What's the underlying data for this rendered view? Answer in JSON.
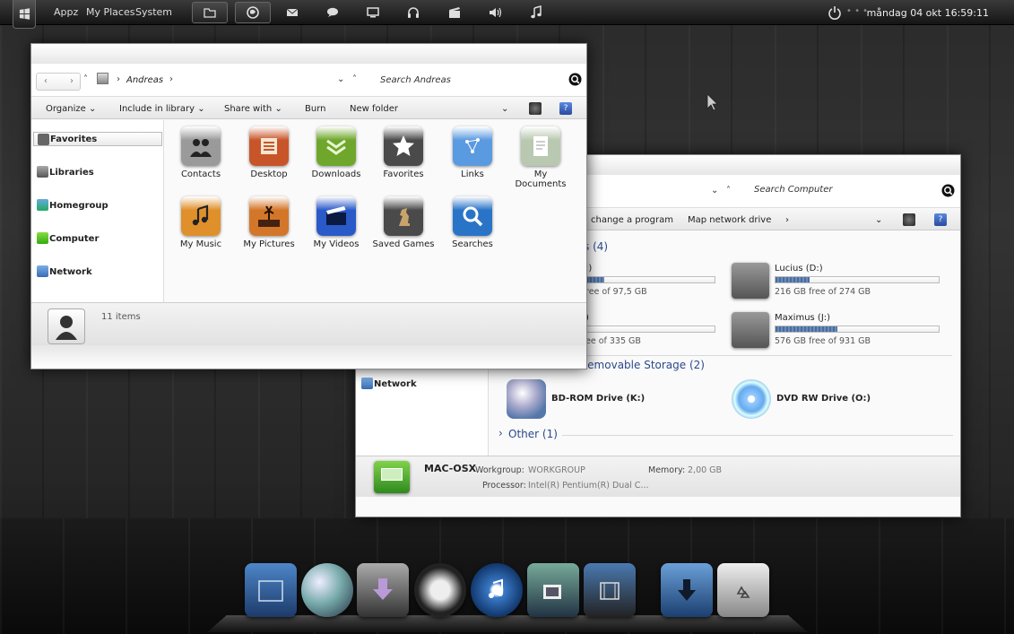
{
  "taskbar": {
    "menus": [
      "Appz",
      "My Places",
      "System"
    ],
    "clock": "måndag 04 okt  16:59:11",
    "icons": [
      "folder-icon",
      "firefox-icon",
      "mail-icon",
      "chat-icon",
      "monitor-icon",
      "headphones-icon",
      "film-icon",
      "volume-icon",
      "music-note-icon"
    ]
  },
  "window1": {
    "breadcrumb": "Andreas",
    "search_placeholder": "Search Andreas",
    "toolbar": [
      "Organize",
      "Include in library",
      "Share with",
      "Burn",
      "New folder"
    ],
    "sidebar": [
      "Favorites",
      "Libraries",
      "Homegroup",
      "Computer",
      "Network"
    ],
    "items": [
      {
        "label": "Contacts",
        "icon": "contacts-icon",
        "color": "#9a9a9a"
      },
      {
        "label": "Desktop",
        "icon": "desktop-icon",
        "color": "#c8552a"
      },
      {
        "label": "Downloads",
        "icon": "downloads-icon",
        "color": "#6ea72c"
      },
      {
        "label": "Favorites",
        "icon": "star-icon",
        "color": "#4a4a4a"
      },
      {
        "label": "Links",
        "icon": "links-icon",
        "color": "#5a9ae0"
      },
      {
        "label": "My Documents",
        "icon": "documents-icon",
        "color": "#b9c8b0"
      },
      {
        "label": "My Music",
        "icon": "music-icon",
        "color": "#e0902a"
      },
      {
        "label": "My Pictures",
        "icon": "pictures-icon",
        "color": "#d4762a"
      },
      {
        "label": "My Videos",
        "icon": "videos-icon",
        "color": "#2a5ac8"
      },
      {
        "label": "Saved Games",
        "icon": "chess-icon",
        "color": "#4a4a4a"
      },
      {
        "label": "Searches",
        "icon": "search-icon",
        "color": "#2a74c8"
      }
    ],
    "status": "11 items"
  },
  "window2": {
    "search_placeholder": "Search Computer",
    "toolbar": [
      "change a program",
      "Map network drive"
    ],
    "sidebar_network": "Network",
    "hdd_group": "s (4)",
    "drives": [
      {
        "name": ":)",
        "free": "ree of 97,5 GB",
        "fill": 0.1
      },
      {
        "name": "Lucius (D:)",
        "free": "216 GB free of 274 GB",
        "fill": 0.21
      },
      {
        "name": ")",
        "free": "ee of 335 GB",
        "fill": 0.1
      },
      {
        "name": "Maximus (J:)",
        "free": "576 GB free of 931 GB",
        "fill": 0.38
      }
    ],
    "removable_group": "Devices with Removable Storage (2)",
    "removable": [
      {
        "name": "BD-ROM Drive (K:)",
        "icon": "bd-rom-icon"
      },
      {
        "name": "DVD RW Drive (O:)",
        "icon": "dvd-icon"
      }
    ],
    "other_group": "Other (1)",
    "details": {
      "computer_name": "MAC-OSX",
      "workgroup_label": "Workgroup:",
      "workgroup": "WORKGROUP",
      "memory_label": "Memory:",
      "memory": "2,00 GB",
      "processor_label": "Processor:",
      "processor": "Intel(R) Pentium(R) Dual  C..."
    }
  },
  "dock": {
    "icons": [
      "finder-icon",
      "globe-icon",
      "install-icon",
      "headphones-icon",
      "itunes-icon",
      "photos-icon",
      "video-icon",
      "downloads-icon",
      "recycle-bin-icon"
    ]
  }
}
